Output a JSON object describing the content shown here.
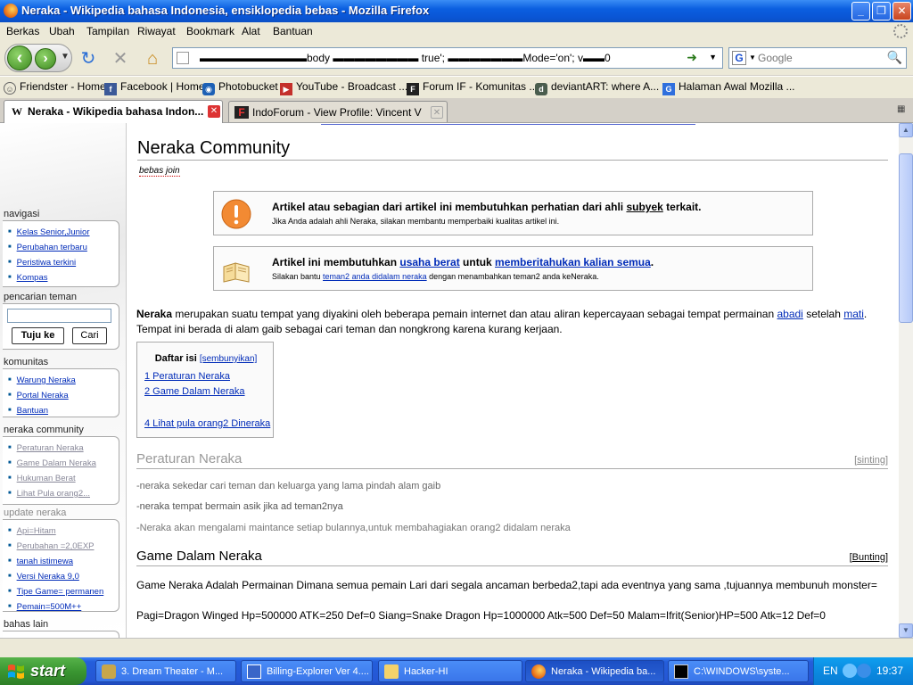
{
  "window": {
    "title": "Neraka - Wikipedia bahasa Indonesia, ensiklopedia bebas - Mozilla Firefox",
    "min_label": "_",
    "restore_label": "❐",
    "close_label": "✕"
  },
  "menu": [
    "Berkas",
    "Ubah",
    "Tampilan",
    "Riwayat",
    "Bookmark",
    "Alat",
    "Bantuan"
  ],
  "navbar": {
    "url": "▬▬▬▬▬▬▬▬▬▬body ▬▬▬▬▬▬▬▬ true'; ▬▬▬▬▬▬▬Mode='on'; v▬▬0",
    "search_placeholder": "Google",
    "search_engine_glyph": "G"
  },
  "bookmarks": [
    {
      "label": "Friendster - Home",
      "icon": "smile-icon",
      "color": "#ffffff"
    },
    {
      "label": "Facebook | Home",
      "icon": "facebook-icon",
      "color": "#3b5998"
    },
    {
      "label": "Photobucket",
      "icon": "photobucket-icon",
      "color": "#1c60b5"
    },
    {
      "label": "YouTube - Broadcast ...",
      "icon": "youtube-icon",
      "color": "#c4302b"
    },
    {
      "label": "Forum IF - Komunitas ...",
      "icon": "forum-icon",
      "color": "#222222"
    },
    {
      "label": "deviantART: where A...",
      "icon": "deviantart-icon",
      "color": "#4a5d4e"
    },
    {
      "label": "Halaman Awal Mozilla ...",
      "icon": "google-icon",
      "color": "#2f6fdd"
    }
  ],
  "tabs": [
    {
      "label": "Neraka - Wikipedia bahasa Indon...",
      "favicon": "W",
      "active": true
    },
    {
      "label": "IndoForum - View Profile: Vincent V",
      "favicon": "F",
      "active": false
    }
  ],
  "sidebar": {
    "navigasi": {
      "heading": "navigasi",
      "items": [
        "Kelas Senior,Junior",
        "Perubahan terbaru",
        "Peristiwa terkini",
        "Kompas"
      ]
    },
    "search": {
      "heading": "pencarian teman",
      "go": "Tuju ke",
      "search": "Cari"
    },
    "komunitas": {
      "heading": "komunitas",
      "items": [
        "Warung Neraka",
        "Portal Neraka",
        "Bantuan"
      ]
    },
    "community": {
      "heading": "neraka community",
      "items": [
        "Peraturan Neraka",
        "Game Dalam Neraka",
        "Hukuman Berat",
        "Lihat Pula orang2..."
      ]
    },
    "update": {
      "heading": "update neraka",
      "items": [
        "Api=Hitam",
        "Perubahan =2,0EXP",
        "tanah istimewa",
        "Versi Neraka 9,0",
        "Tipe Game= permanen",
        "Pemain=500M++"
      ]
    },
    "bahas": {
      "heading": "bahas lain"
    }
  },
  "article": {
    "title": "Neraka Community",
    "subtitle": "bebas join",
    "ambox1": {
      "main": "Artikel atau sebagian dari artikel ini membutuhkan perhatian dari ahli ",
      "main_link": "subyek",
      "main_end": " terkait.",
      "sub": "Jika Anda adalah ahli Neraka, silakan membantu memperbaiki kualitas artikel ini."
    },
    "ambox2": {
      "main_a": "Artikel ini membutuhkan ",
      "link1": "usaha berat",
      "main_b": " untuk ",
      "link2": "memberitahukan kalian semua",
      "main_c": ".",
      "sub_a": "Silakan bantu ",
      "sub_link": "teman2 anda didalam neraka",
      "sub_b": " dengan menambahkan teman2 anda keNeraka."
    },
    "intro": {
      "bold": "Neraka",
      "a": " merupakan suatu tempat yang diyakini oleh beberapa pemain internet  dan atau aliran kepercayaan sebagai tempat permainan ",
      "link1": "abadi",
      "b": " setelah ",
      "link2": "mati",
      "c": ". Tempat ini berada di alam gaib sebagai cari teman dan nongkrong karena kurang kerjaan."
    },
    "toc": {
      "title": "Daftar isi",
      "toggle": "[sembunyikan]",
      "items": [
        "1 Peraturan Neraka",
        "2 Game Dalam Neraka",
        "4 Lihat pula orang2 Dineraka"
      ]
    },
    "section1": {
      "heading": "Peraturan Neraka",
      "edit": "sinting",
      "rules": [
        "-neraka sekedar cari teman dan keluarga yang lama pindah alam gaib",
        "-neraka tempat bermain asik jika ad teman2nya",
        "-Neraka akan mengalami maintance setiap bulannya,untuk membahagiakan orang2 didalam neraka"
      ]
    },
    "section2": {
      "heading": "Game Dalam Neraka",
      "edit": "Bunting",
      "line1": "Game Neraka Adalah Permainan Dimana semua pemain Lari dari segala ancaman berbeda2,tapi ada eventnya yang sama ,tujuannya membunuh monster=",
      "line2": "Pagi=Dragon Winged Hp=500000 ATK=250 Def=0 Siang=Snake Dragon Hp=1000000 Atk=500 Def=50 Malam=Ifrit(Senior)HP=500 Atk=12 Def=0"
    }
  },
  "taskbar": {
    "start": "start",
    "tasks": [
      {
        "label": "3. Dream Theater - M...",
        "icon": "winamp-icon",
        "active": false
      },
      {
        "label": "Billing-Explorer Ver 4....",
        "icon": "billing-icon",
        "active": false
      },
      {
        "label": "Hacker-HI",
        "icon": "folder-icon",
        "active": false
      },
      {
        "label": "Neraka - Wikipedia ba...",
        "icon": "firefox-icon",
        "active": true
      },
      {
        "label": "C:\\WINDOWS\\syste...",
        "icon": "cmd-icon",
        "active": false
      }
    ],
    "lang": "EN",
    "clock": "19:37"
  }
}
